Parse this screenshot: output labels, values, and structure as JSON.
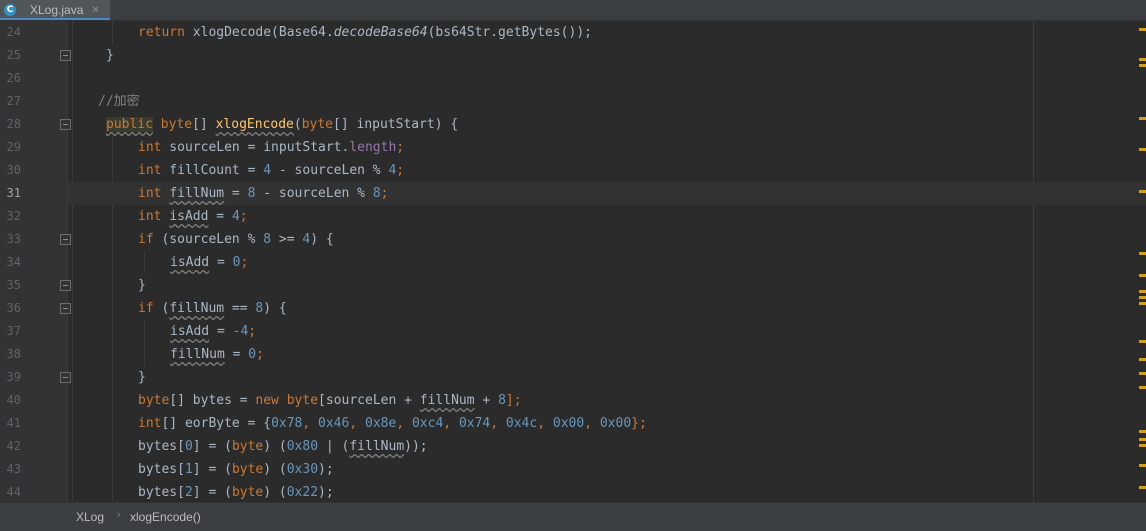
{
  "tab": {
    "icon_letter": "C",
    "filename": "XLog.java",
    "close": "✕"
  },
  "breadcrumb": {
    "class_name": "XLog",
    "separator": "›",
    "method": "xlogEncode()"
  },
  "line_numbers": [
    "24",
    "25",
    "26",
    "27",
    "28",
    "29",
    "30",
    "31",
    "32",
    "33",
    "34",
    "35",
    "36",
    "37",
    "38",
    "39",
    "40",
    "41",
    "42",
    "43",
    "44"
  ],
  "code": {
    "l24": [
      "return",
      " xlogDecode(Base64.",
      "decodeBase64",
      "(bs64Str.getBytes());"
    ],
    "l25": [
      "}"
    ],
    "l27": [
      "//加密"
    ],
    "l28": [
      "public",
      " ",
      "byte",
      "[] ",
      "xlogEncode",
      "(",
      "byte",
      "[] inputStart) {"
    ],
    "l29": [
      "int",
      " sourceLen = inputStart.",
      "length",
      ";"
    ],
    "l30": [
      "int",
      " fillCount = ",
      "4",
      " - sourceLen % ",
      "4",
      ";"
    ],
    "l31": [
      "int",
      " ",
      "fillNum",
      " = ",
      "8",
      " - sourceLen % ",
      "8",
      ";"
    ],
    "l32": [
      "int",
      " ",
      "isAdd",
      " = ",
      "4",
      ";"
    ],
    "l33": [
      "if",
      " (sourceLen % ",
      "8",
      " >= ",
      "4",
      ") {"
    ],
    "l34": [
      "isAdd",
      " = ",
      "0",
      ";"
    ],
    "l35": [
      "}"
    ],
    "l36": [
      "if",
      " (",
      "fillNum",
      " == ",
      "8",
      ") {"
    ],
    "l37": [
      "isAdd",
      " = ",
      "-4",
      ";"
    ],
    "l38": [
      "fillNum",
      " = ",
      "0",
      ";"
    ],
    "l39": [
      "}"
    ],
    "l40": [
      "byte",
      "[] bytes = ",
      "new",
      " ",
      "byte",
      "[sourceLen + ",
      "fillNum",
      " + ",
      "8",
      "];"
    ],
    "l41": [
      "int",
      "[] eorByte = {",
      "0x78",
      ", ",
      "0x46",
      ", ",
      "0x8e",
      ", ",
      "0xc4",
      ", ",
      "0x74",
      ", ",
      "0x4c",
      ", ",
      "0x00",
      ", ",
      "0x00",
      "};"
    ],
    "l42": [
      "bytes[",
      "0",
      "] = (",
      "byte",
      ") (",
      "0x80",
      " | (",
      "fillNum",
      "));"
    ],
    "l43": [
      "bytes[",
      "1",
      "] = (",
      "byte",
      ") (",
      "0x30",
      ");"
    ],
    "l44": [
      "bytes[",
      "2",
      "] = (",
      "byte",
      ") (",
      "0x22",
      ");"
    ]
  },
  "colors": {
    "keyword": "#cc7832",
    "number": "#6897bb",
    "field": "#9876aa",
    "comment": "#808080",
    "method_decl": "#ffc66d",
    "text": "#a9b7c6",
    "background": "#2b2b2b",
    "gutter": "#313335"
  },
  "icons": {
    "tab": "java-class-icon",
    "gutter_bulb": "lightbulb-icon"
  }
}
